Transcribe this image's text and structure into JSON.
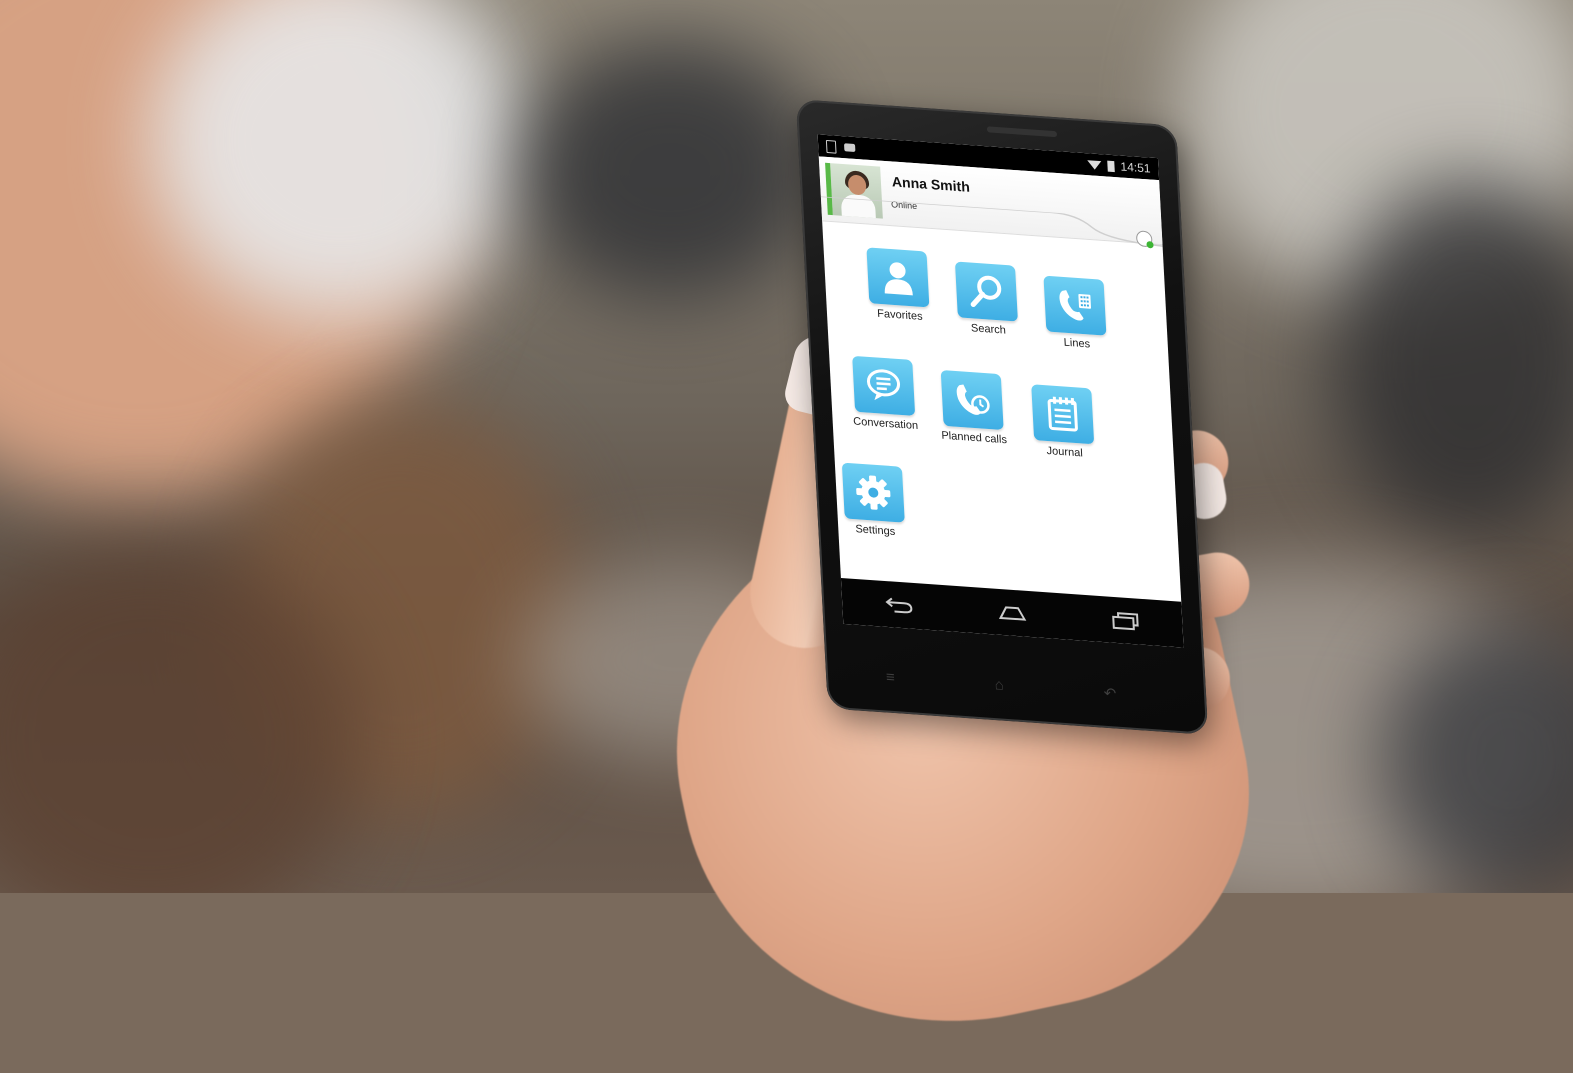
{
  "status_bar": {
    "time": "14:51"
  },
  "profile": {
    "name": "Anna Smith",
    "status": "Online"
  },
  "menu": {
    "favorites": "Favorites",
    "search": "Search",
    "lines": "Lines",
    "conversation": "Conversation",
    "planned_calls": "Planned calls",
    "journal": "Journal",
    "settings": "Settings"
  },
  "icons": {
    "favorites": "person-icon",
    "search": "magnifier-icon",
    "lines": "desk-phone-icon",
    "conversation": "chat-bubble-icon",
    "planned_calls": "phone-clock-icon",
    "journal": "notepad-icon",
    "settings": "gear-icon"
  },
  "colors": {
    "tile_light": "#6fd0f3",
    "tile_dark": "#3eaee4",
    "presence_green": "#3db534",
    "status_bar_bg": "#000000"
  }
}
